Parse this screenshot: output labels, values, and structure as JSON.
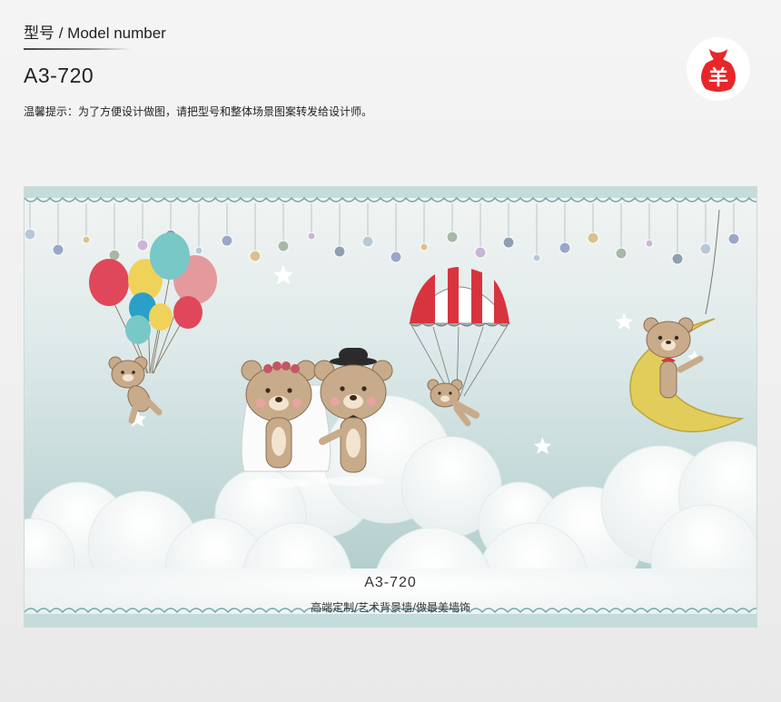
{
  "header": {
    "label": "型号 / Model number",
    "model_code": "A3-720",
    "hint": "温馨提示：为了方便设计做图，请把型号和整体场景图案转发给设计师。"
  },
  "logo": {
    "icon": "sheep-bag-logo",
    "glyph": "羊",
    "color": "#e8262a"
  },
  "artwork": {
    "theme": "teddy bears wedding in the clouds",
    "watermark_code": "A3-720",
    "watermark_slogan": "高端定制/艺术背景墙/做最美墙饰",
    "colors": {
      "sky": "#c6dcdc",
      "cloud": "#ffffff",
      "bear": "#c8ab8b",
      "balloon_red": "#e0475a",
      "balloon_teal": "#78c8c8",
      "balloon_yellow": "#f0d25a",
      "moon": "#e2cd5a",
      "parachute_red": "#d8343e"
    }
  }
}
